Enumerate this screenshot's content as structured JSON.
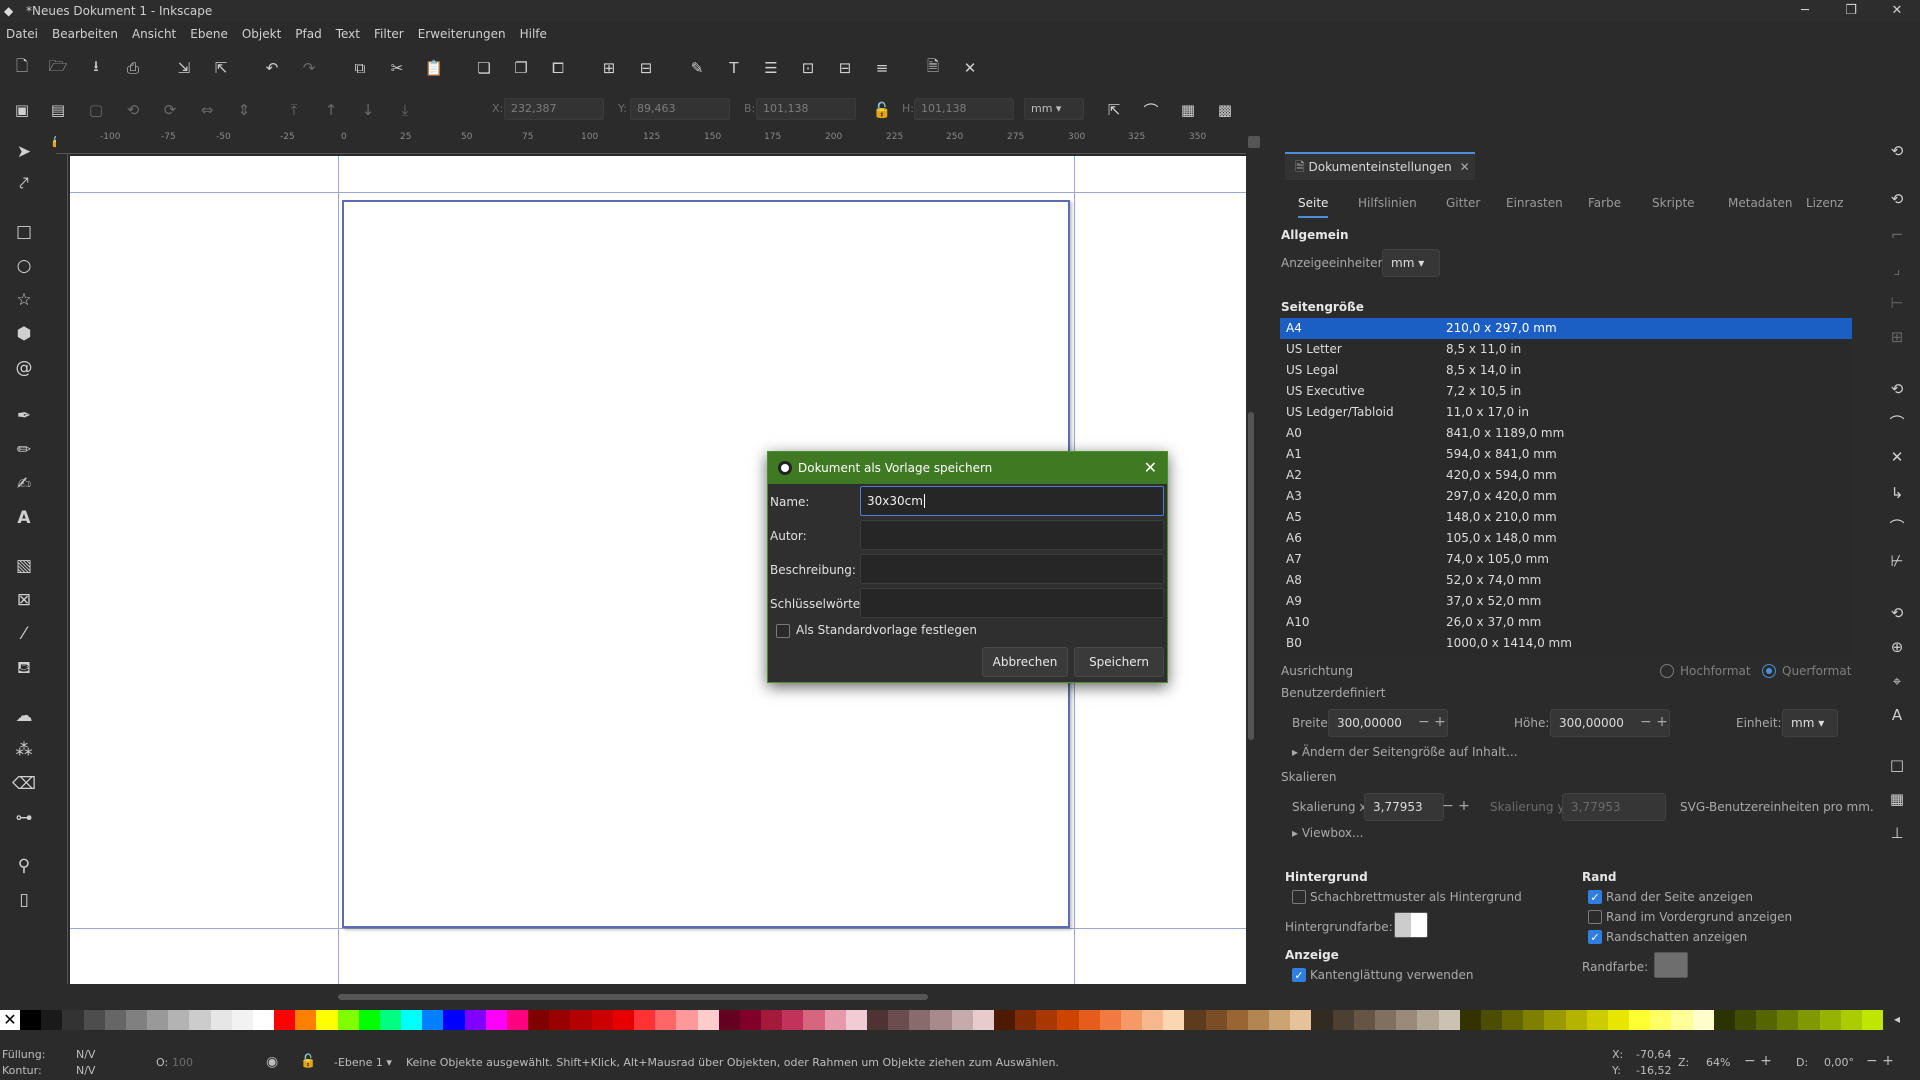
{
  "window": {
    "title": "*Neues Dokument 1 - Inkscape",
    "controls": [
      "─",
      "❐",
      "✕"
    ]
  },
  "menu": [
    "Datei",
    "Bearbeiten",
    "Ansicht",
    "Ebene",
    "Objekt",
    "Pfad",
    "Text",
    "Filter",
    "Erweiterungen",
    "Hilfe"
  ],
  "toolctrl": {
    "x_label": "X:",
    "x_value": "232,387",
    "y_label": "Y:",
    "y_value": "89,463",
    "w_label": "B:",
    "w_value": "101,138",
    "h_label": "H:",
    "h_value": "101,138",
    "unit": "mm"
  },
  "ruler_top": [
    "-100",
    "-75",
    "-50",
    "-25",
    "0",
    "25",
    "50",
    "75",
    "100",
    "125",
    "150",
    "175",
    "200",
    "225",
    "250",
    "275",
    "300",
    "325",
    "350"
  ],
  "dialog": {
    "title": "Dokument als Vorlage speichern",
    "name_label": "Name:",
    "name_value": "30x30cm",
    "author_label": "Autor:",
    "author_value": "",
    "desc_label": "Beschreibung:",
    "desc_value": "",
    "keywords_label": "Schlüsselwörter:",
    "keywords_value": "",
    "default_label": "Als Standardvorlage festlegen",
    "cancel": "Abbrechen",
    "save": "Speichern"
  },
  "panel": {
    "tab_title": "Dokumenteinstellungen",
    "tabs": [
      "Seite",
      "Hilfslinien",
      "Gitter",
      "Einrasten",
      "Farbe",
      "Skripte",
      "Metadaten",
      "Lizenz"
    ],
    "general": "Allgemein",
    "display_units_label": "Anzeigeeinheiten:",
    "display_units": "mm",
    "page_size": "Seitengröße",
    "sizes": [
      {
        "name": "A4",
        "size": "210,0 x 297,0 mm"
      },
      {
        "name": "US Letter",
        "size": "8,5 x 11,0 in"
      },
      {
        "name": "US Legal",
        "size": "8,5 x 14,0 in"
      },
      {
        "name": "US Executive",
        "size": "7,2 x 10,5 in"
      },
      {
        "name": "US Ledger/Tabloid",
        "size": "11,0 x 17,0 in"
      },
      {
        "name": "A0",
        "size": "841,0 x 1189,0 mm"
      },
      {
        "name": "A1",
        "size": "594,0 x 841,0 mm"
      },
      {
        "name": "A2",
        "size": "420,0 x 594,0 mm"
      },
      {
        "name": "A3",
        "size": "297,0 x 420,0 mm"
      },
      {
        "name": "A5",
        "size": "148,0 x 210,0 mm"
      },
      {
        "name": "A6",
        "size": "105,0 x 148,0 mm"
      },
      {
        "name": "A7",
        "size": "74,0 x 105,0 mm"
      },
      {
        "name": "A8",
        "size": "52,0 x 74,0 mm"
      },
      {
        "name": "A9",
        "size": "37,0 x 52,0 mm"
      },
      {
        "name": "A10",
        "size": "26,0 x 37,0 mm"
      },
      {
        "name": "B0",
        "size": "1000,0 x 1414,0 mm"
      }
    ],
    "orientation_label": "Ausrichtung",
    "portrait": "Hochformat",
    "landscape": "Querformat",
    "custom": "Benutzerdefiniert",
    "width_label": "Breite:",
    "width_value": "300,00000",
    "height_label": "Höhe:",
    "height_value": "300,00000",
    "unit_label": "Einheit:",
    "unit_value": "mm",
    "resize_label": "Ändern der Seitengröße auf Inhalt...",
    "scale": "Skalieren",
    "scale_x_label": "Skalierung x:",
    "scale_x_value": "3,77953",
    "scale_y_label": "Skalierung y:",
    "scale_y_value": "3,77953",
    "svg_units": "SVG-Benutzereinheiten pro mm.",
    "viewbox": "Viewbox...",
    "background": "Hintergrund",
    "checker_label": "Schachbrettmuster als Hintergrund",
    "bg_color_label": "Hintergrundfarbe:",
    "border": "Rand",
    "show_border": "Rand der Seite anzeigen",
    "border_top": "Rand im Vordergrund anzeigen",
    "border_shadow": "Randschatten anzeigen",
    "border_color_label": "Randfarbe:",
    "display": "Anzeige",
    "antialias": "Kantenglättung verwenden"
  },
  "palette_colors": [
    "#000000",
    "#1a1a1a",
    "#333333",
    "#4d4d4d",
    "#666666",
    "#808080",
    "#999999",
    "#b3b3b3",
    "#cccccc",
    "#e6e6e6",
    "#f2f2f2",
    "#ffffff",
    "#ff0000",
    "#ff8000",
    "#ffff00",
    "#80ff00",
    "#00ff00",
    "#00ff80",
    "#00ffff",
    "#0080ff",
    "#0000ff",
    "#8000ff",
    "#ff00ff",
    "#ff0080",
    "#800000",
    "#990000",
    "#b30000",
    "#cc0000",
    "#e60000",
    "#ff3333",
    "#ff6666",
    "#ff9999",
    "#ffcccc",
    "#660022",
    "#80002a",
    "#a31a3d",
    "#c2335c",
    "#d6667f",
    "#e699aa",
    "#f2ccd5",
    "#4d3333",
    "#6b4d4d",
    "#8a6b6b",
    "#a88a8a",
    "#c7aaaa",
    "#e6cccc",
    "#4d1a00",
    "#802b00",
    "#a63800",
    "#cc4400",
    "#e65c1a",
    "#f27a40",
    "#f59966",
    "#f8b88c",
    "#fbd6b3",
    "#5e3b1c",
    "#7a4d26",
    "#996633",
    "#b38553",
    "#cca373",
    "#e6c299",
    "#332b22",
    "#4d4033",
    "#665545",
    "#807060",
    "#998a7a",
    "#b3a695",
    "#ccc2b3",
    "#333300",
    "#4d4d00",
    "#666600",
    "#808000",
    "#999900",
    "#b3b300",
    "#cccc00",
    "#e6e600",
    "#ffff33",
    "#ffff66",
    "#ffff99",
    "#ffffcc",
    "#2b3300",
    "#404d00",
    "#556600",
    "#6b8000",
    "#809900",
    "#95b300",
    "#aacc00",
    "#bfe600"
  ],
  "status": {
    "fill_label": "Füllung:",
    "fill_value": "N/V",
    "stroke_label": "Kontur:",
    "stroke_value": "N/V",
    "opacity_label": "O:",
    "opacity_value": "100",
    "layer": "-Ebene 1",
    "message": "Keine Objekte ausgewählt. Shift+Klick, Alt+Mausrad über Objekten, oder Rahmen um Objekte ziehen zum Auswählen.",
    "x_label": "X:",
    "x_value": "-70,64",
    "y_label": "Y:",
    "y_value": "-16,52",
    "zoom_label": "Z:",
    "zoom_value": "64%",
    "rot_label": "D:",
    "rot_value": "0,00°"
  }
}
